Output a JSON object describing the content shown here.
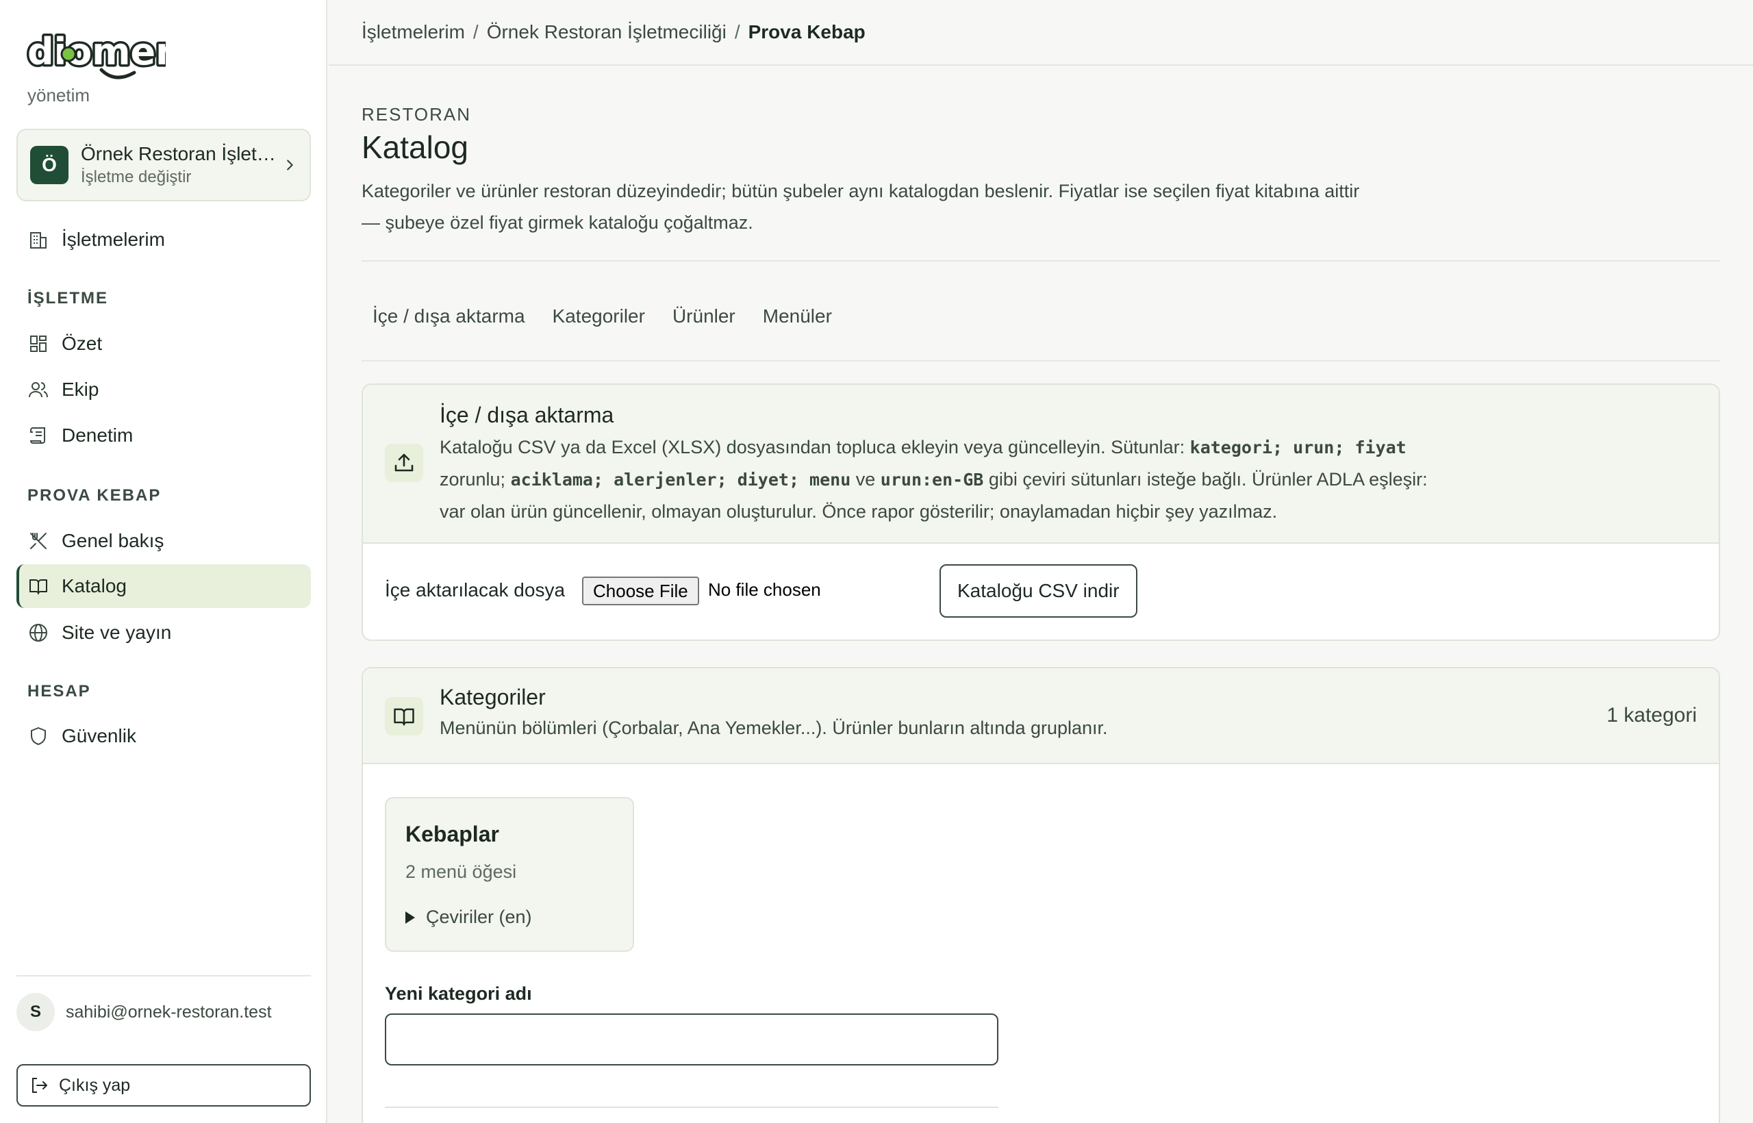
{
  "app": {
    "logo_text": "diomenu",
    "logo_subtitle": "yönetim"
  },
  "business_switcher": {
    "avatar_letter": "Ö",
    "name": "Örnek Restoran İşletmeciliği",
    "subtitle": "İşletme değiştir"
  },
  "sidebar": {
    "top_item": {
      "label": "İşletmelerim",
      "icon": "building-icon"
    },
    "sections": [
      {
        "title": "İŞLETME",
        "items": [
          {
            "label": "Özet",
            "icon": "dashboard-icon"
          },
          {
            "label": "Ekip",
            "icon": "users-icon"
          },
          {
            "label": "Denetim",
            "icon": "scroll-icon"
          }
        ]
      },
      {
        "title": "PROVA KEBAP",
        "items": [
          {
            "label": "Genel bakış",
            "icon": "utensils-icon"
          },
          {
            "label": "Katalog",
            "icon": "book-open-icon",
            "active": true
          },
          {
            "label": "Site ve yayın",
            "icon": "globe-icon"
          }
        ]
      },
      {
        "title": "HESAP",
        "items": [
          {
            "label": "Güvenlik",
            "icon": "shield-icon"
          }
        ]
      }
    ],
    "user": {
      "avatar_letter": "S",
      "email": "sahibi@ornek-restoran.test"
    },
    "logout_label": "Çıkış yap"
  },
  "breadcrumb": {
    "items": [
      "İşletmelerim",
      "Örnek Restoran İşletmeciliği"
    ],
    "separator": "/",
    "current": "Prova Kebap"
  },
  "page": {
    "eyebrow": "RESTORAN",
    "title": "Katalog",
    "description": "Kategoriler ve ürünler restoran düzeyindedir; bütün şubeler aynı katalogdan beslenir. Fiyatlar ise seçilen fiyat kitabına aittir — şubeye özel fiyat girmek kataloğu çoğaltmaz."
  },
  "tabs": [
    "İçe / dışa aktarma",
    "Kategoriler",
    "Ürünler",
    "Menüler"
  ],
  "import_card": {
    "title": "İçe / dışa aktarma",
    "desc_1": "Kataloğu CSV ya da Excel (XLSX) dosyasından topluca ekleyin veya güncelleyin. Sütunlar: ",
    "code_required": "kategori; urun; fiyat",
    "desc_2": "zorunlu; ",
    "code_optional": "aciklama; alerjenler; diyet; menu",
    "desc_3": " ve ",
    "code_translation": "urun:en-GB",
    "desc_4": " gibi çeviri sütunları isteğe bağlı. Ürünler ADLA eşleşir:",
    "desc_5": "var olan ürün güncellenir, olmayan oluşturulur. Önce rapor gösterilir; onaylamadan hiçbir şey yazılmaz.",
    "file_label": "İçe aktarılacak dosya",
    "file_button": "Choose File",
    "file_status": "No file chosen",
    "download_button": "Kataloğu CSV indir"
  },
  "categories_card": {
    "title": "Kategoriler",
    "description": "Menünün bölümleri (Çorbalar, Ana Yemekler...). Ürünler bunların altında gruplanır.",
    "count_label": "1 kategori",
    "items": [
      {
        "name": "Kebaplar",
        "count": "2 menü öğesi",
        "translations": "Çeviriler (en)"
      }
    ],
    "new_label": "Yeni kategori adı",
    "new_placeholder": ""
  },
  "colors": {
    "brand_dark": "#1f4d35",
    "accent_light": "#e8f0dc",
    "logo_green": "#7cc242"
  }
}
